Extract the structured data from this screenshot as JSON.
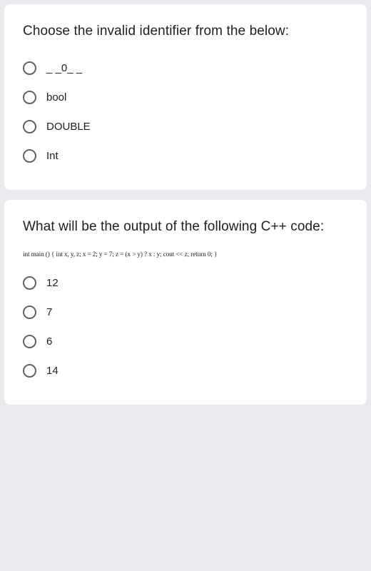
{
  "q1": {
    "question": "Choose the invalid identifier from the below:",
    "options": [
      "_ _0_ _",
      "bool",
      "DOUBLE",
      "Int"
    ]
  },
  "q2": {
    "question": "What will be the output of the following C++ code:",
    "code": "int main ()  {     int x, y, z;     x = 2;     y = 7;     z = (x > y) ? x : y;     cout << z;   return 0;  }",
    "options": [
      "12",
      "7",
      "6",
      "14"
    ]
  }
}
